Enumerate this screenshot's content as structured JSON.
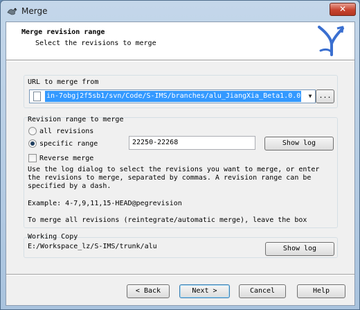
{
  "window": {
    "title": "Merge",
    "close_glyph": "✕"
  },
  "header": {
    "title": "Merge revision range",
    "subtitle": "Select the revisions to merge"
  },
  "url_group": {
    "label": "URL to merge from",
    "value": "in-7obgj2f5sb1/svn/Code/S-IMS/branches/alu_JiangXia_Beta1.0.0",
    "browse_label": "..."
  },
  "range_group": {
    "label": "Revision range to merge",
    "all_revisions_label": "all revisions",
    "specific_range_label": "specific range",
    "selected": "specific range",
    "range_value": "22250-22268",
    "show_log_label": "Show log",
    "reverse_merge_label": "Reverse merge",
    "reverse_merge_checked": false,
    "help_lines": [
      "Use the log dialog to select the revisions you want to merge, or enter",
      "the revisions to merge, separated by commas. A revision range can be",
      "specified by a dash."
    ],
    "example": "Example: 4-7,9,11,15-HEAD@pegrevision",
    "note": "To merge all revisions (reintegrate/automatic merge), leave the box"
  },
  "working_copy": {
    "label": "Working Copy",
    "path": "E:/Workspace_lz/S-IMS/trunk/alu",
    "show_log_label": "Show log"
  },
  "footer": {
    "back_label": "Back",
    "next_label": "Next",
    "cancel_label": "Cancel",
    "help_label": "Help"
  }
}
